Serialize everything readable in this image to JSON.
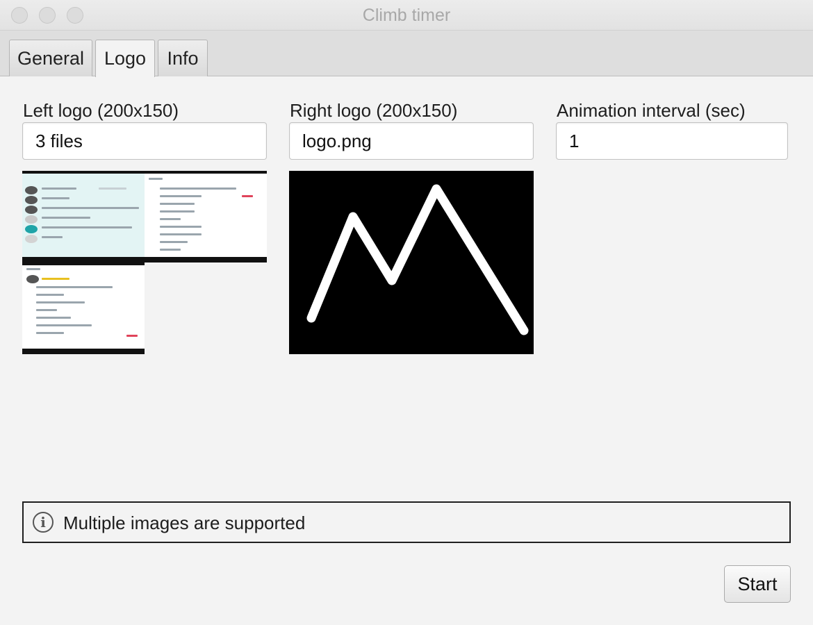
{
  "window": {
    "title": "Climb timer"
  },
  "tabs": [
    {
      "label": "General"
    },
    {
      "label": "Logo"
    },
    {
      "label": "Info"
    }
  ],
  "active_tab": "Logo",
  "left_logo": {
    "label": "Left logo (200x150)",
    "value": "3 files"
  },
  "right_logo": {
    "label": "Right logo (200x150)",
    "value": "logo.png"
  },
  "animation_interval": {
    "label": "Animation interval (sec)",
    "value": "1"
  },
  "info": {
    "icon": "info-icon",
    "message": "Multiple images are supported"
  },
  "start_button": {
    "label": "Start"
  },
  "colors": {
    "background": "#f3f3f3",
    "logo_background": "#000000",
    "logo_stroke": "#ffffff"
  }
}
